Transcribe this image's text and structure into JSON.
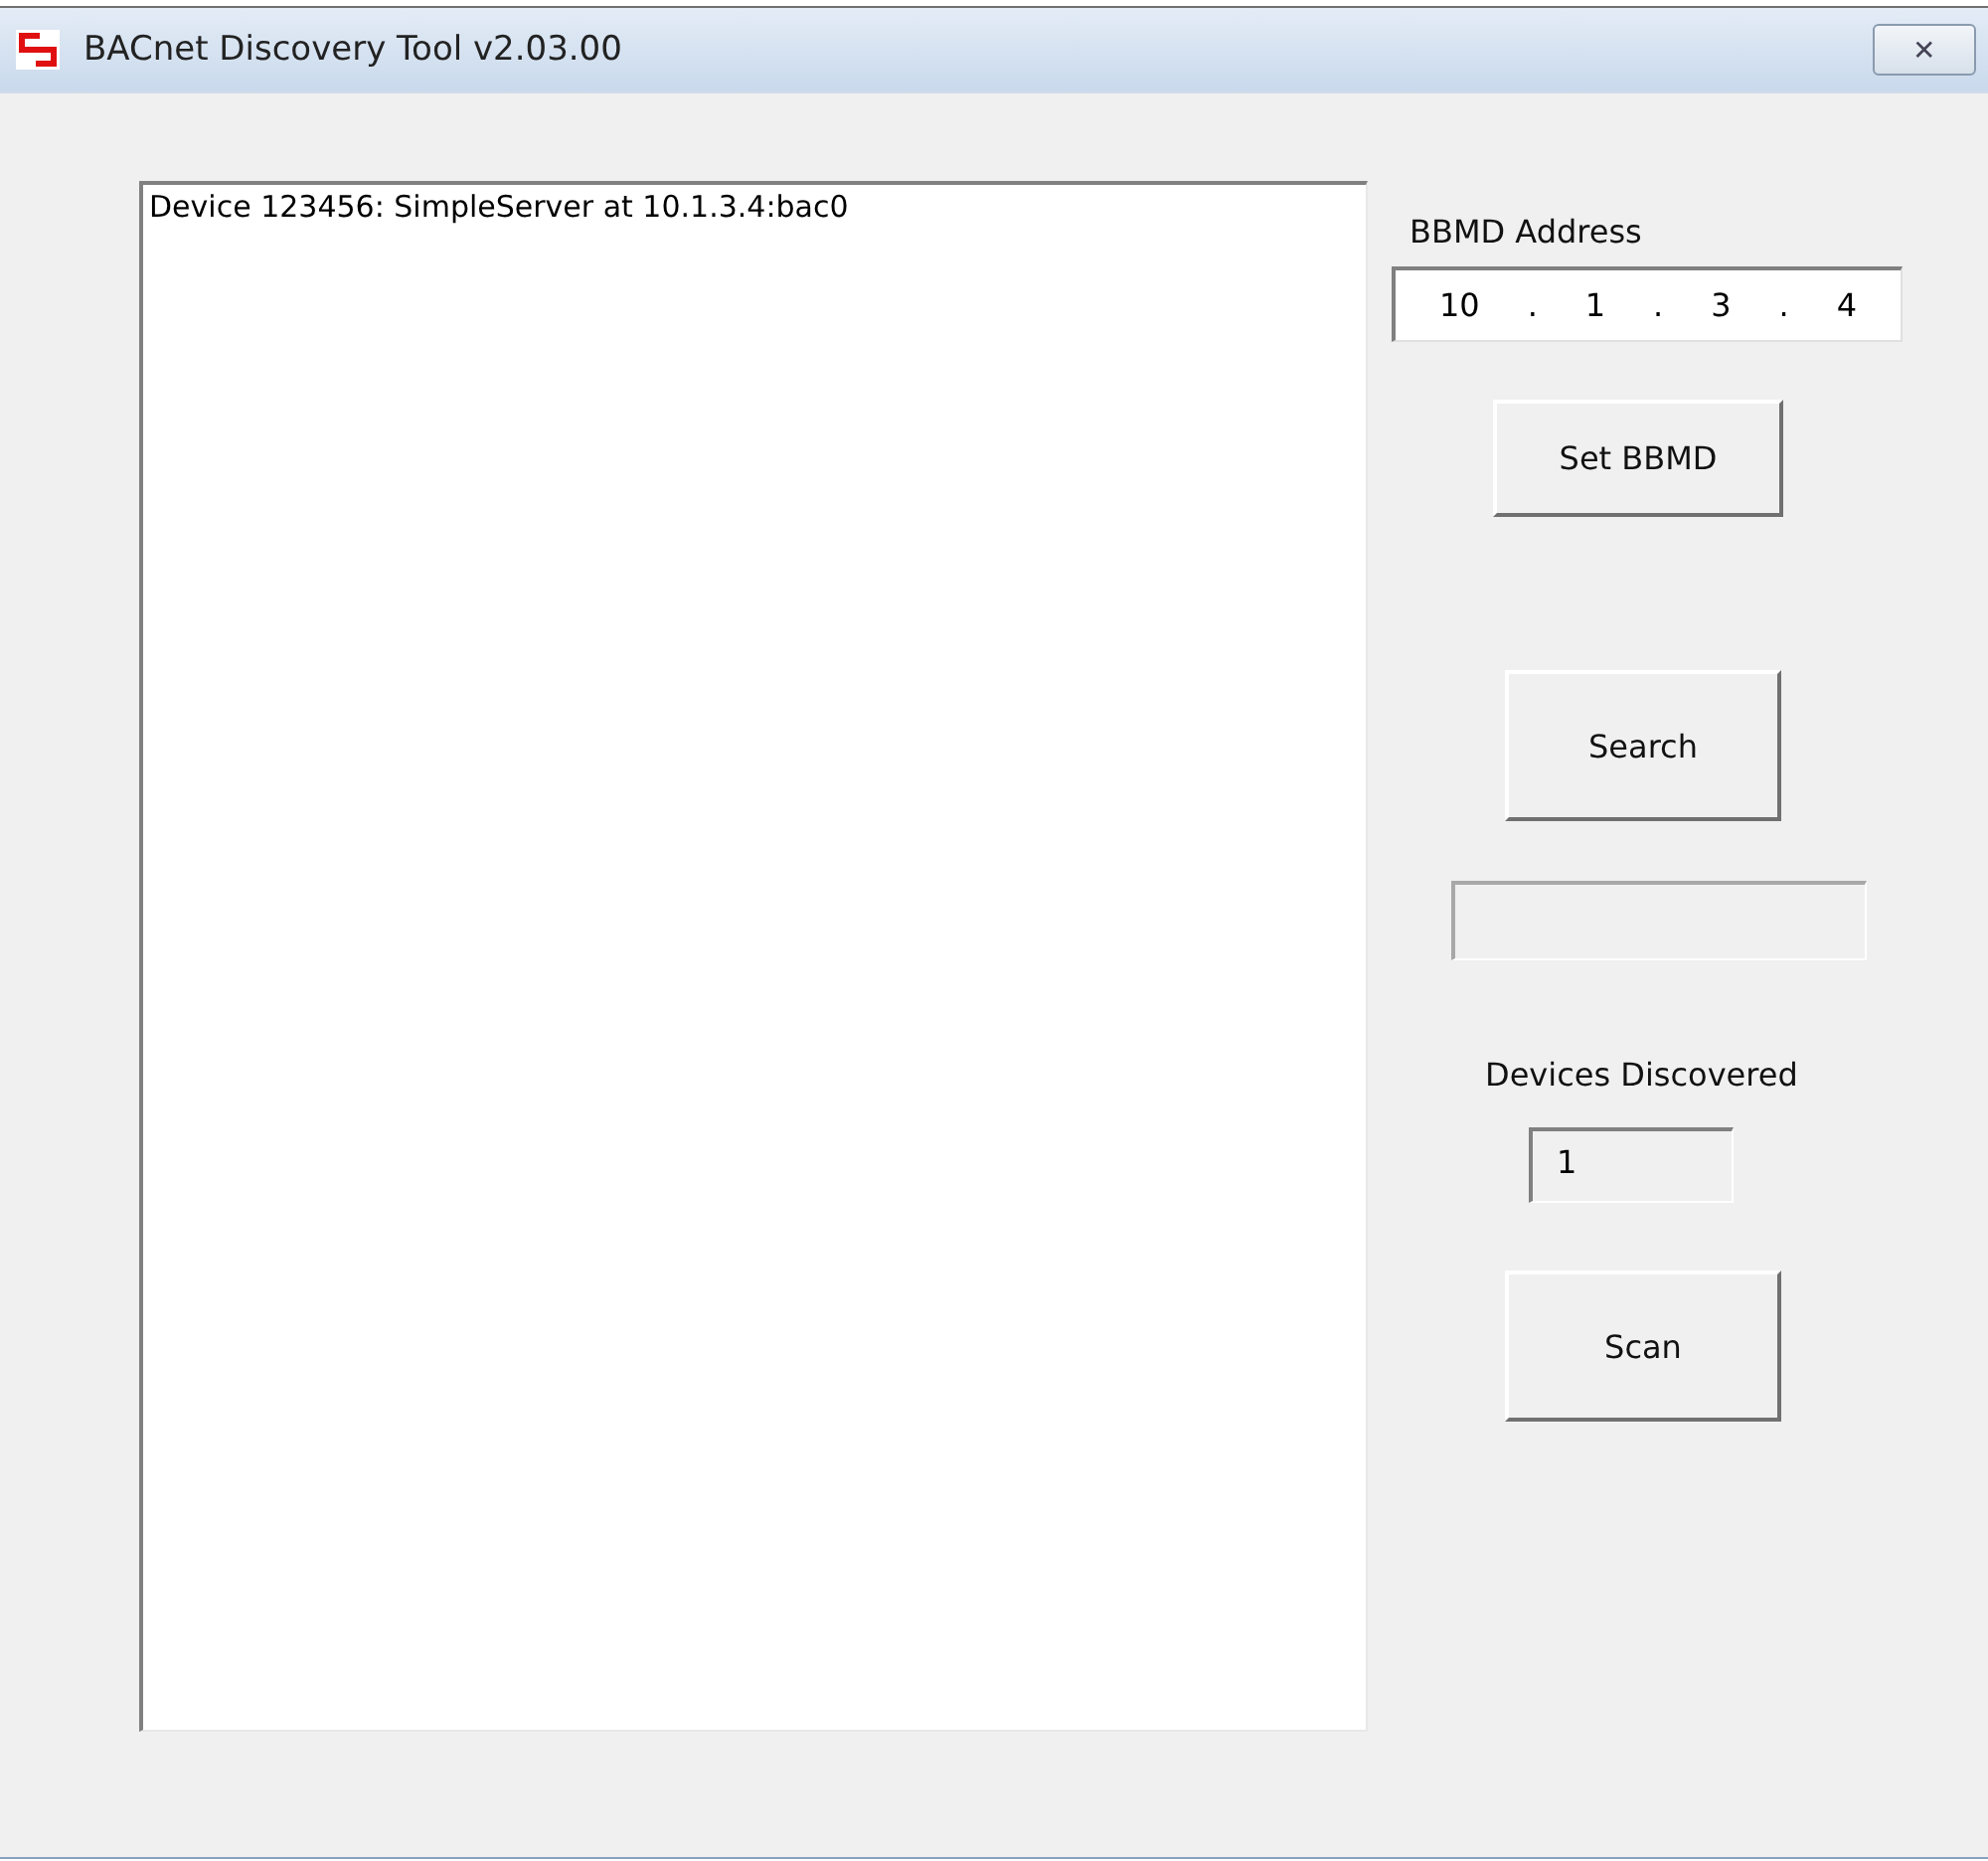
{
  "window": {
    "title": "BACnet Discovery Tool v2.03.00",
    "close": "✕"
  },
  "device_list": {
    "items": [
      "Device 123456: SimpleServer at 10.1.3.4:bac0"
    ]
  },
  "bbmd": {
    "label": "BBMD Address",
    "octets": [
      "10",
      "1",
      "3",
      "4"
    ],
    "separator": ".",
    "button": "Set BBMD"
  },
  "search": {
    "button": "Search"
  },
  "devices_discovered": {
    "label": "Devices Discovered",
    "value": "1"
  },
  "scan": {
    "button": "Scan"
  }
}
